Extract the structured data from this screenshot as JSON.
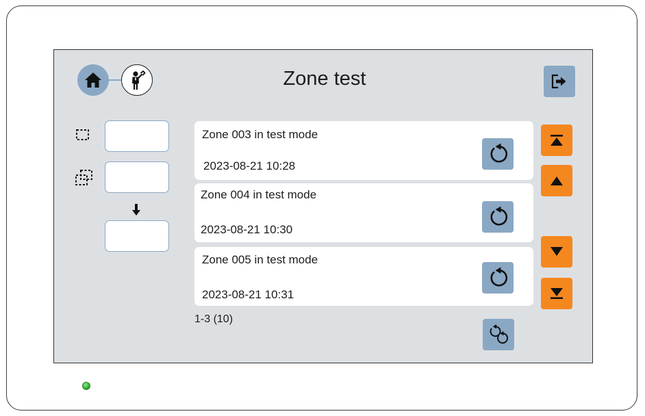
{
  "header": {
    "title": "Zone test"
  },
  "icons": {
    "home": "home-icon",
    "technician": "technician-icon",
    "logout": "logout-icon",
    "area_select": "dashed-square-icon",
    "area_multi": "dashed-squares-icon",
    "arrow": "arrow-down-icon",
    "reset": "reset-icon",
    "reset_all": "reset-all-icon",
    "nav_top": "first-page-icon",
    "nav_up": "page-up-icon",
    "nav_down": "page-down-icon",
    "nav_bottom": "last-page-icon"
  },
  "colors": {
    "screen_bg": "#dde0e3",
    "button_blue": "#8aa8c4",
    "button_orange": "#f5871f",
    "led_green": "#2cb32c"
  },
  "inputs": {
    "from_value": "",
    "to_value": "",
    "result_value": ""
  },
  "zones": [
    {
      "label": "Zone 003 in test mode",
      "timestamp": "2023-08-21  10:28"
    },
    {
      "label": "Zone 004 in test mode",
      "timestamp": "2023-08-21  10:30"
    },
    {
      "label": "Zone 005 in test mode",
      "timestamp": "2023-08-21  10:31"
    }
  ],
  "pagination": {
    "label": "1-3 (10)"
  }
}
